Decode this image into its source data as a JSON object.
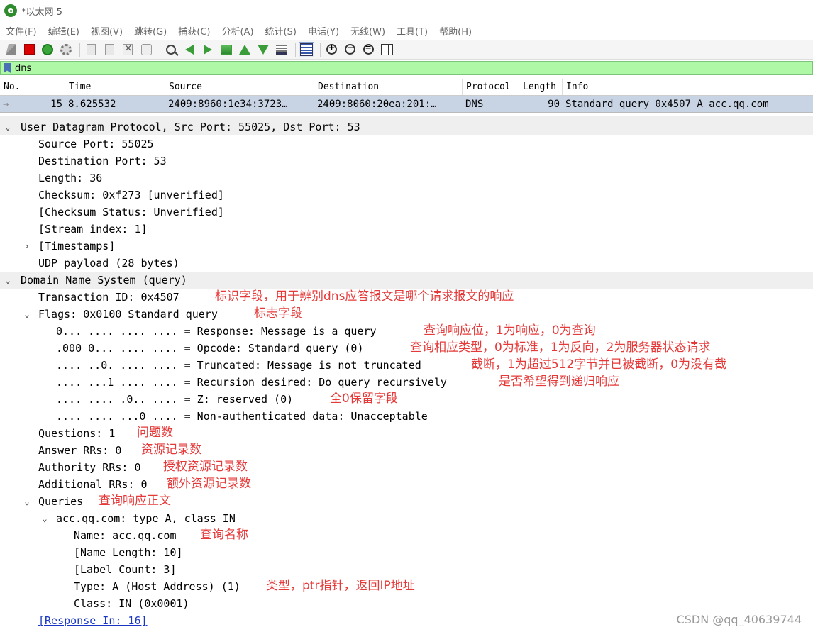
{
  "window": {
    "title": "*以太网 5"
  },
  "menu": [
    "文件(F)",
    "编辑(E)",
    "视图(V)",
    "跳转(G)",
    "捕获(C)",
    "分析(A)",
    "统计(S)",
    "电话(Y)",
    "无线(W)",
    "工具(T)",
    "帮助(H)"
  ],
  "toolbar": {
    "icons": [
      "shark-fin-icon",
      "stop-capture-icon",
      "restart-capture-icon",
      "capture-options-icon",
      "open-file-icon",
      "save-file-icon",
      "close-file-icon",
      "reload-file-icon",
      "find-packet-icon",
      "go-back-icon",
      "go-forward-icon",
      "go-to-packet-icon",
      "first-packet-icon",
      "last-packet-icon",
      "autoscroll-icon",
      "colorize-icon",
      "zoom-in-icon",
      "zoom-out-icon",
      "normal-size-icon",
      "resize-columns-icon"
    ]
  },
  "filter": {
    "value": "dns"
  },
  "packet_list": {
    "columns": [
      "No.",
      "Time",
      "Source",
      "Destination",
      "Protocol",
      "Length",
      "Info"
    ],
    "rows": [
      {
        "no": "15",
        "time": "8.625532",
        "source": "2409:8960:1e34:3723…",
        "destination": "2409:8060:20ea:201:…",
        "protocol": "DNS",
        "length": "90",
        "info": "Standard query 0x4507 A acc.qq.com"
      }
    ]
  },
  "detail": {
    "udp_header": "User Datagram Protocol, Src Port: 55025, Dst Port: 53",
    "src_port": "Source Port: 55025",
    "dst_port": "Destination Port: 53",
    "length": "Length: 36",
    "checksum": "Checksum: 0xf273 [unverified]",
    "checksum_status": "[Checksum Status: Unverified]",
    "stream_index": "[Stream index: 1]",
    "timestamps": "[Timestamps]",
    "udp_payload": "UDP payload (28 bytes)",
    "dns_header": "Domain Name System (query)",
    "transaction_id": "Transaction ID: 0x4507",
    "flags": "Flags: 0x0100 Standard query",
    "flag_response": "0... .... .... .... = Response: Message is a query",
    "flag_opcode": ".000 0... .... .... = Opcode: Standard query (0)",
    "flag_truncated": ".... ..0. .... .... = Truncated: Message is not truncated",
    "flag_recursion": ".... ...1 .... .... = Recursion desired: Do query recursively",
    "flag_z": ".... .... .0.. .... = Z: reserved (0)",
    "flag_nonauth": ".... .... ...0 .... = Non-authenticated data: Unacceptable",
    "questions": "Questions: 1",
    "answer_rrs": "Answer RRs: 0",
    "authority_rrs": "Authority RRs: 0",
    "additional_rrs": "Additional RRs: 0",
    "queries": "Queries",
    "query_entry": "acc.qq.com: type A, class IN",
    "name": "Name: acc.qq.com",
    "name_length": "[Name Length: 10]",
    "label_count": "[Label Count: 3]",
    "type": "Type: A (Host Address) (1)",
    "class": "Class: IN (0x0001)",
    "response_in": "[Response In: 16]"
  },
  "annotations": {
    "transaction_id": "标识字段，用于辨别dns应答报文是哪个请求报文的响应",
    "flags": "标志字段",
    "response": "查询响应位，1为响应，0为查询",
    "opcode": "查询相应类型，0为标准，1为反向，2为服务器状态请求",
    "truncated": "截断，1为超过512字节并已被截断，0为没有截",
    "recursion": "是否希望得到递归响应",
    "z": "全0保留字段",
    "questions": "问题数",
    "answer_rrs": "资源记录数",
    "authority_rrs": "授权资源记录数",
    "additional_rrs": "额外资源记录数",
    "queries": "查询响应正文",
    "name": "查询名称",
    "type": "类型，ptr指针，返回IP地址"
  },
  "watermark": "CSDN @qq_40639744",
  "colors": {
    "filter_bg": "#aff9a6",
    "selected_row": "#c8d3e4",
    "annotation": "#e63a3a",
    "link": "#1a37c4"
  }
}
